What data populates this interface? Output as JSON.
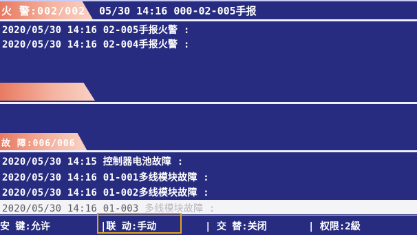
{
  "fire_section": {
    "tab_label": "火  警:002/002",
    "header_event": "05/30 14:16 000-02-005手报",
    "rows": [
      "2020/05/30 14:16 02-005手报火警 :",
      "2020/05/30 14:16 02-004手报火警 :"
    ]
  },
  "fault_section": {
    "tab_label": "故 障:006/006",
    "rows": [
      "2020/05/30 14:15 控制器电池故障 :",
      "2020/05/30 14:16 01-001多线模块故障 :",
      "2020/05/30 14:16 01-002多线模块故障 :"
    ],
    "selected_row": {
      "prefix": "2020/05/30 14:16 01-003 ",
      "suffix": "多线模块故障 :"
    }
  },
  "status_bar": {
    "key": "安 键:允许",
    "linkage": "|联 动:手动",
    "alternate": "| 交  替:关闭",
    "permission": "| 权限:2級"
  },
  "colors": {
    "background": "#272c80",
    "tab_gradient_start": "#e87a62",
    "tab_gradient_end": "#f9d2c6",
    "highlight_border": "#e6a520"
  }
}
